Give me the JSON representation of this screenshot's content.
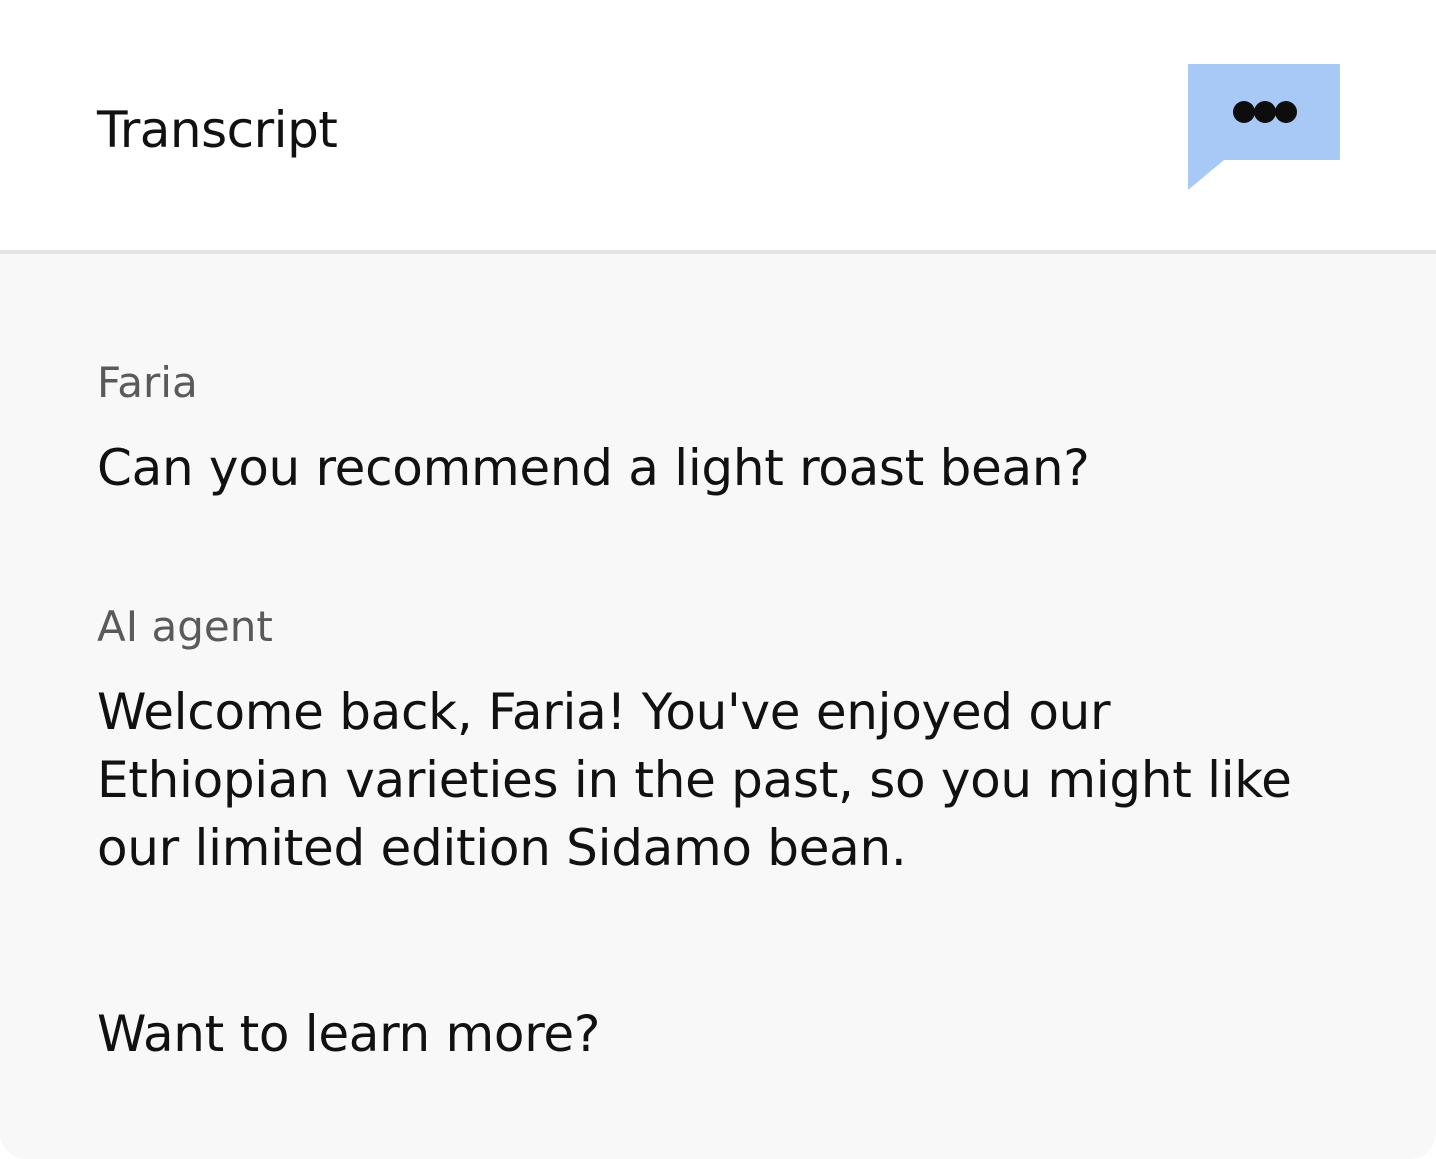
{
  "header": {
    "title": "Transcript",
    "icon": "chat-bubble-ellipsis-icon",
    "icon_color": "#a8c8f5"
  },
  "transcript": {
    "messages": [
      {
        "speaker": "Faria",
        "text": "Can you recommend a light roast bean?"
      },
      {
        "speaker": "AI agent",
        "text": "Welcome back, Faria! You've enjoyed our Ethiopian varieties in the past, so you might like our limited edition Sidamo bean."
      }
    ],
    "followup": "Want to learn more?"
  }
}
